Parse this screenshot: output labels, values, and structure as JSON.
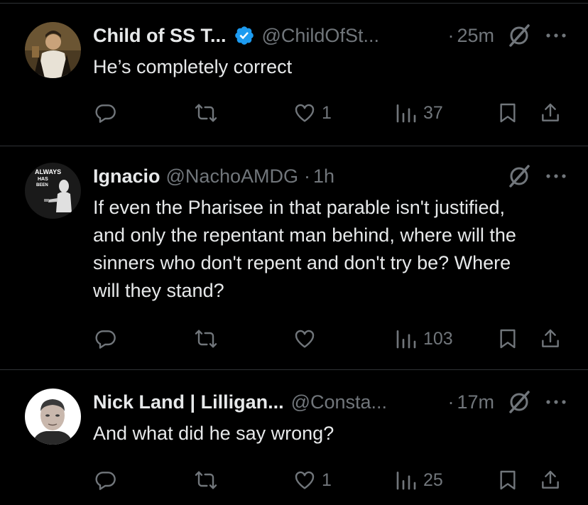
{
  "colors": {
    "background": "#000000",
    "text_primary": "#e7e9ea",
    "text_secondary": "#71767b",
    "divider": "#2f3336",
    "verified_badge": "#1d9bf0"
  },
  "tweets": [
    {
      "name": "Child of SS T...",
      "verified": true,
      "handle": "@ChildOfSt...",
      "separator": "·",
      "time": "25m",
      "text": "He’s completely correct",
      "replies": "",
      "reposts": "",
      "likes": "1",
      "views": "37",
      "avatar_icon": "saint-portrait-avatar"
    },
    {
      "name": "Ignacio",
      "verified": false,
      "handle": "@NachoAMDG",
      "separator": "·",
      "time": "1h",
      "text": "If even the Pharisee in that parable isn't justified, and only the repentant man behind, where will the sinners who don't repent and don't try be? Where will they stand?",
      "replies": "",
      "reposts": "",
      "likes": "",
      "views": "103",
      "avatar_icon": "always-has-been-avatar",
      "avatar_text": [
        "ALWAYS",
        "HAS",
        "BEEN"
      ]
    },
    {
      "name": "Nick Land | Lilligan...",
      "verified": false,
      "handle": "@Consta...",
      "separator": "·",
      "time": "17m",
      "text": "And what did he say wrong?",
      "replies": "",
      "reposts": "",
      "likes": "1",
      "views": "25",
      "avatar_icon": "bald-man-avatar"
    }
  ]
}
